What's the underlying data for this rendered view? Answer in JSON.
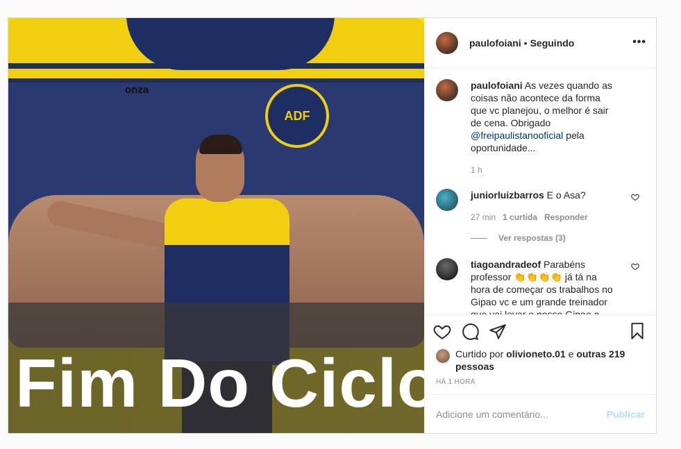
{
  "post": {
    "caption_overlay": "Fim Do Ciclo",
    "image_text": {
      "brand": "onza",
      "crest": "ADF"
    }
  },
  "header": {
    "username": "paulofoiani",
    "separator": "•",
    "follow_status": "Seguindo",
    "more": "•••"
  },
  "caption": {
    "username": "paulofoiani",
    "text_before": " As vezes quando as coisas não acontece da forma que vc planejou, o melhor é sair de cena. Obrigado ",
    "mention": "@freipaulistanooficial",
    "text_after": " pela oportunidade...",
    "time": "1 h"
  },
  "comments": [
    {
      "username": "juniorluizbarros",
      "text": " E o Asa?",
      "time": "27 min",
      "likes": "1 curtida",
      "reply": "Responder",
      "view_replies": "Ver respostas (3)"
    },
    {
      "username": "tiagoandradeof",
      "text": " Parabéns professor 👏👏👏👏 já tá na hora de começar os trabalhos no Gipao vc e um grande treinador que vai levar o nosso Gipao a"
    }
  ],
  "likes": {
    "prefix": "Curtido por ",
    "user": "olivioneto.01",
    "mid": " e ",
    "others": "outras 219 pessoas"
  },
  "timestamp": "HÁ 1 HORA",
  "add_comment": {
    "placeholder": "Adicione um comentário...",
    "publish": "Publicar"
  },
  "icons": [
    "heart-icon",
    "comment-icon",
    "share-icon",
    "bookmark-icon",
    "more-icon"
  ]
}
